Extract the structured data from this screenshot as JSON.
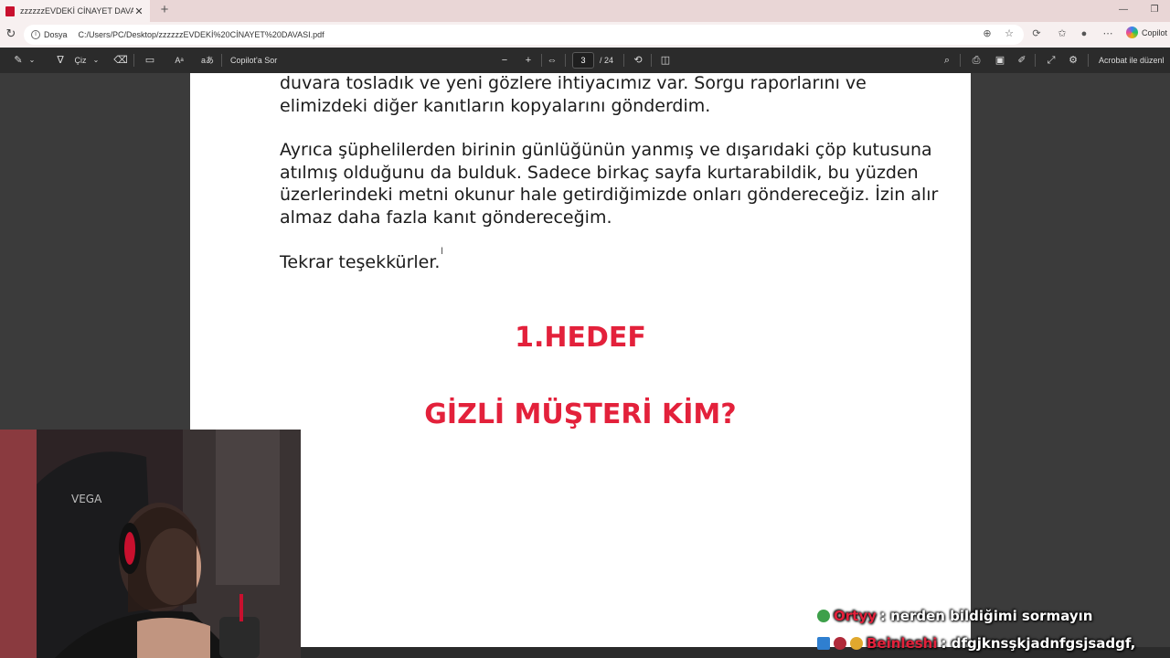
{
  "browser": {
    "tab_title": "zzzzzzEVDEKİ CİNAYET DAVASI.pdf",
    "tab_close": "✕",
    "new_tab": "+",
    "address_chip": "Dosya",
    "url": "C:/Users/PC/Desktop/zzzzzzEVDEKİ%20CİNAYET%20DAVASI.pdf",
    "copilot_label": "Copilot"
  },
  "pdf_toolbar": {
    "draw_label": "Çiz",
    "copilot_ask": "Copilot'a Sor",
    "current_page": "3",
    "total_pages": "/ 24",
    "acrobat_label": "Acrobat ile düzenl"
  },
  "document": {
    "paragraph_1": "duvara tosladık ve yeni gözlere ihtiyacımız var. Sorgu raporlarını ve elimizdeki diğer kanıtların kopyalarını gönderdim.",
    "paragraph_2": "Ayrıca şüphelilerden birinin günlüğünün yanmış ve dışarıdaki çöp kutusuna atılmış olduğunu da bulduk. Sadece birkaç sayfa kurtarabildik, bu yüzden üzerlerindeki metni okunur hale getirdiğimizde onları göndereceğiz. İzin alır almaz daha fazla kanıt göndereceğim.",
    "closing": "Tekrar teşekkürler.",
    "heading_1": "1.HEDEF",
    "heading_2": "GİZLİ MÜŞTERİ KİM?"
  },
  "webcam": {
    "chair_brand": "VEGA"
  },
  "chat": [
    {
      "user": "Ortyy",
      "message": ": nerden bildiğimi sormayın"
    },
    {
      "user": "Beinleshi",
      "message": ": dfgjknsşkjadnfgsjsadgf,"
    }
  ],
  "colors": {
    "accent_red": "#e3213b",
    "toolbar_bg": "#2b2b2b",
    "tabbar_bg": "#e9d6d6"
  }
}
